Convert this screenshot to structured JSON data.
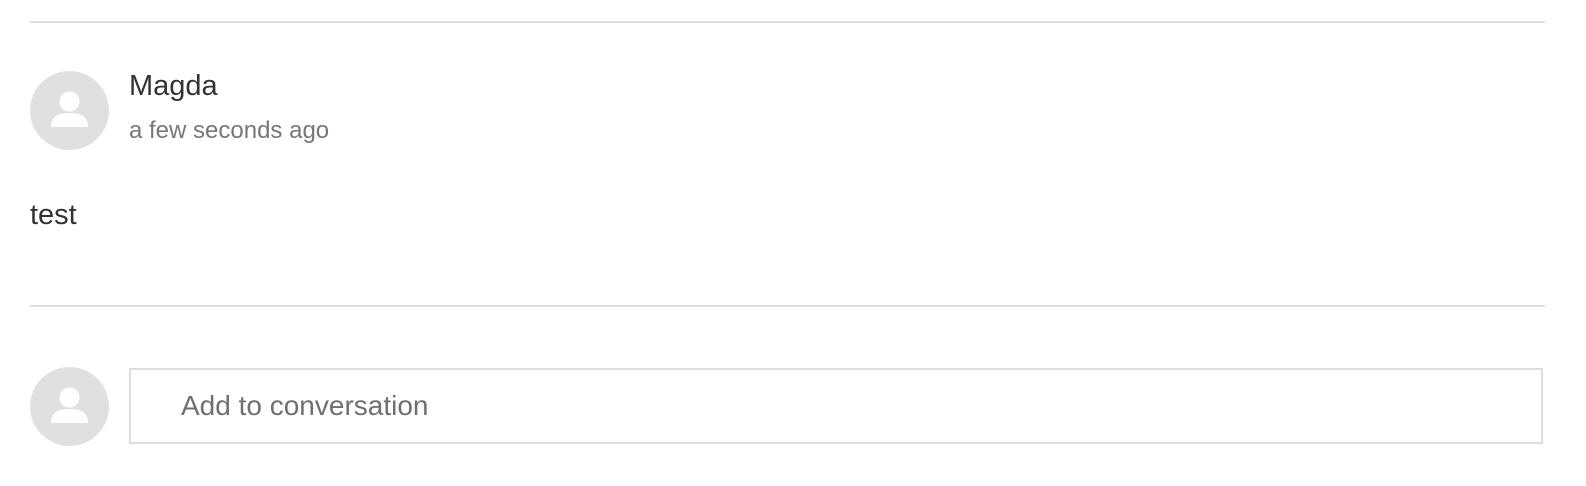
{
  "comment": {
    "author": "Magda",
    "timestamp": "a few seconds ago",
    "body": "test",
    "avatar_icon": "user-icon"
  },
  "composer": {
    "placeholder": "Add to conversation",
    "value": "",
    "avatar_icon": "user-icon"
  },
  "colors": {
    "avatar_bg": "#e0e0e0",
    "avatar_figure": "#ffffff",
    "divider": "#e0e0e0",
    "text_primary": "#333333",
    "text_secondary": "#777777",
    "input_border": "#dddddd"
  }
}
